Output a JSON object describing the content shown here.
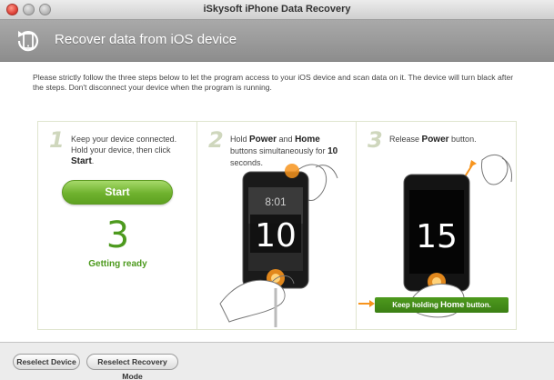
{
  "window": {
    "title": "iSkysoft iPhone Data Recovery"
  },
  "header": {
    "title": "Recover data from iOS device",
    "icon": "restore-device-icon"
  },
  "instructions": "Please strictly follow the three steps below to let the program access to your iOS device and scan data on it. The device will turn black after the steps. Don't disconnect your device when the program is running.",
  "steps": [
    {
      "number": "1",
      "text_a": "Keep your device connected.",
      "text_b": "Hold your device, then click",
      "text_bold": "Start",
      "text_end": ".",
      "button": "Start",
      "countdown": "3",
      "status": "Getting ready"
    },
    {
      "number": "2",
      "text_a": "Hold ",
      "bold1": "Power",
      "text_b": " and ",
      "bold2": "Home",
      "text_c": " buttons simultaneously for ",
      "bold3": "10",
      "text_d": " seconds.",
      "phone_time": "8:01",
      "phone_count": "10"
    },
    {
      "number": "3",
      "text_a": "Release ",
      "bold1": "Power",
      "text_b": " button.",
      "phone_count": "15",
      "banner_a": "Keep holding ",
      "banner_bold": "Home",
      "banner_b": " button."
    }
  ],
  "footer": {
    "reselect_device": "Reselect Device",
    "reselect_mode": "Reselect Recovery Mode"
  },
  "colors": {
    "accent_green": "#4d9a1e",
    "orange_glow": "#f7941d"
  }
}
